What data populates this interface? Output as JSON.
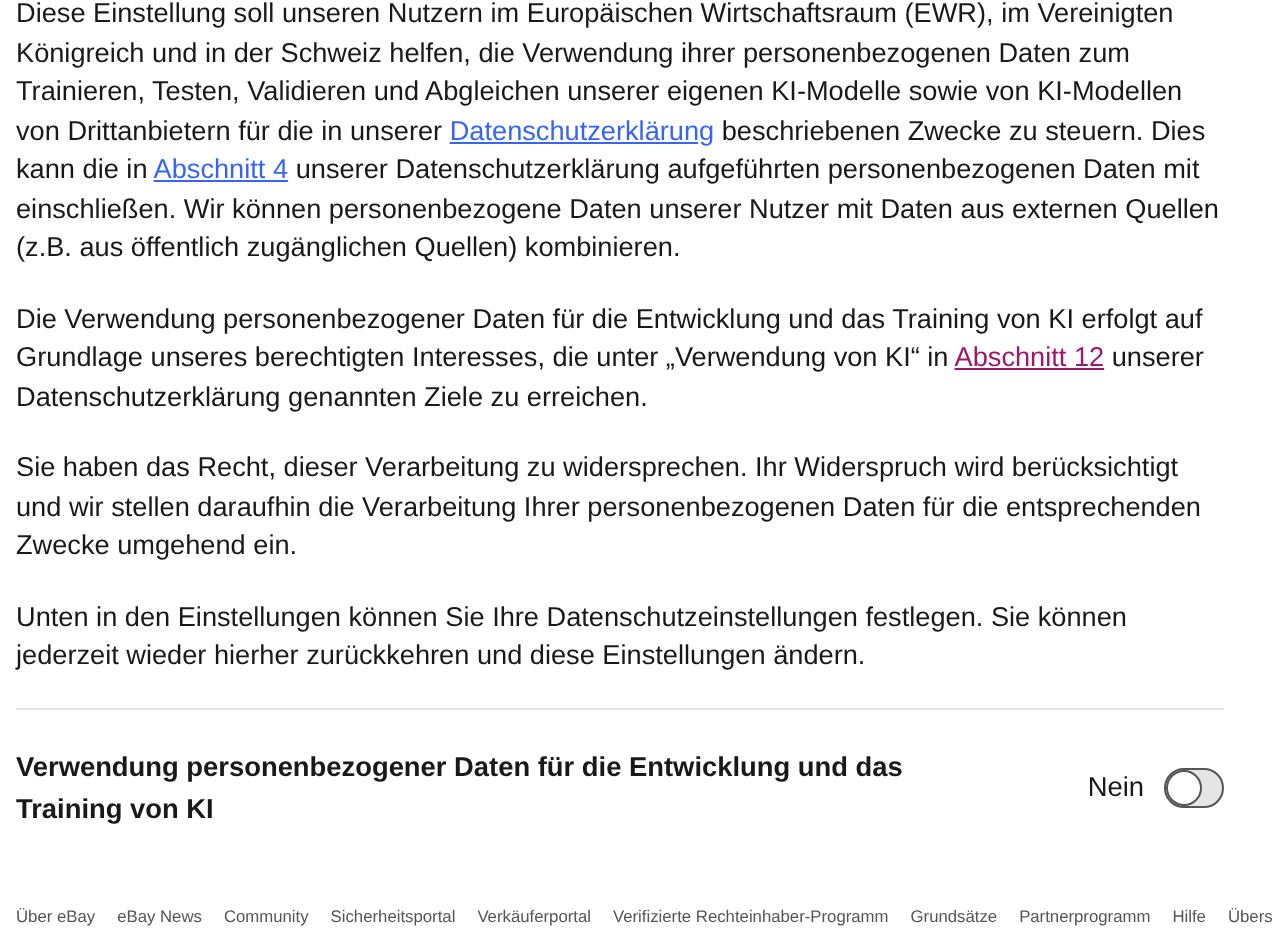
{
  "paragraphs": [
    [
      {
        "kind": "text",
        "text": "Diese Einstellung soll unseren Nutzern im Europäischen Wirtschaftsraum (EWR), im Vereinigten Königreich und in der Schweiz helfen, die Verwendung ihrer personenbezogenen Daten zum Trainieren, Testen, Validieren und Abgleichen unserer eigenen KI-Modelle sowie von KI-Modellen von Drittanbietern für die in unserer "
      },
      {
        "kind": "link",
        "text": "Datenschutzerklärung",
        "visited": false
      },
      {
        "kind": "text",
        "text": " beschriebenen Zwecke zu steuern. Dies kann die in "
      },
      {
        "kind": "link",
        "text": "Abschnitt 4",
        "visited": false
      },
      {
        "kind": "text",
        "text": " unserer Datenschutzerklärung aufgeführten personenbezogenen Daten mit einschließen. Wir können personenbezogene Daten unserer Nutzer mit Daten aus externen Quellen (z.B. aus öffentlich zugänglichen Quellen) kombinieren."
      }
    ],
    [
      {
        "kind": "text",
        "text": "Die Verwendung personenbezogener Daten für die Entwicklung und das Training von KI erfolgt auf Grundlage unseres berechtigten Interesses, die unter „Verwendung von KI“ in "
      },
      {
        "kind": "link",
        "text": "Abschnitt 12",
        "visited": true
      },
      {
        "kind": "text",
        "text": " unserer Datenschutzerklärung genannten Ziele zu erreichen."
      }
    ],
    [
      {
        "kind": "text",
        "text": "Sie haben das Recht, dieser Verarbeitung zu widersprechen. Ihr Widerspruch wird berücksichtigt und wir stellen daraufhin die Verarbeitung Ihrer personenbezogenen Daten für die entsprechenden Zwecke umgehend ein."
      }
    ],
    [
      {
        "kind": "text",
        "text": "Unten in den Einstellungen können Sie Ihre Datenschutzeinstellungen festlegen. Sie können jederzeit wieder hierher zurückkehren und diese Einstellungen ändern."
      }
    ]
  ],
  "setting": {
    "title": "Verwendung personenbezogener Daten für die Entwicklung und das Training von KI",
    "state_label": "Nein",
    "checked": false
  },
  "footer_links": [
    "Über eBay",
    "eBay News",
    "Community",
    "Sicherheitsportal",
    "Verkäuferportal",
    "Verifizierte Rechteinhaber-Programm",
    "Grundsätze",
    "Partnerprogramm",
    "Hilfe",
    "Übers"
  ]
}
